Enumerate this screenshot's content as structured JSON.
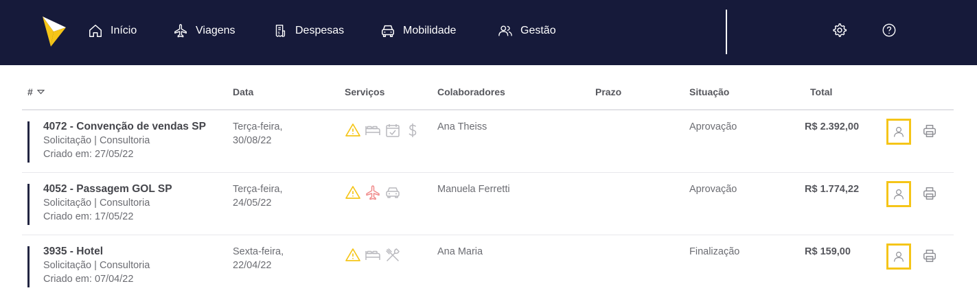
{
  "nav": {
    "items": [
      {
        "label": "Início",
        "icon": "home-icon"
      },
      {
        "label": "Viagens",
        "icon": "airplane-icon"
      },
      {
        "label": "Despesas",
        "icon": "receipt-icon"
      },
      {
        "label": "Mobilidade",
        "icon": "car-icon"
      },
      {
        "label": "Gestão",
        "icon": "users-icon"
      }
    ],
    "right_icons": [
      "gear-icon",
      "help-icon"
    ]
  },
  "colors": {
    "topbar": "#161a3a",
    "accent": "#f5c518",
    "alert": "#f5c518",
    "flight_service": "#f08a8a",
    "row_bar": "#222542"
  },
  "table": {
    "columns": [
      "#",
      "Data",
      "Serviços",
      "Colaboradores",
      "Prazo",
      "Situação",
      "Total"
    ],
    "rows": [
      {
        "title": "4072 - Convenção de vendas SP",
        "type": "Solicitação | Consultoria",
        "created": "Criado em: 27/05/22",
        "weekday": "Terça-feira,",
        "date": "30/08/22",
        "services": [
          "alert-icon",
          "bed-icon",
          "calendar-check-icon",
          "dollar-icon"
        ],
        "collaborator": "Ana Theiss",
        "deadline": "",
        "status": "Aprovação",
        "total": "R$ 2.392,00"
      },
      {
        "title": "4052 - Passagem GOL SP",
        "type": "Solicitação | Consultoria",
        "created": "Criado em: 17/05/22",
        "weekday": "Terça-feira,",
        "date": "24/05/22",
        "services": [
          "alert-icon",
          "airplane-icon",
          "car-icon"
        ],
        "collaborator": "Manuela Ferretti",
        "deadline": "",
        "status": "Aprovação",
        "total": "R$ 1.774,22"
      },
      {
        "title": "3935 - Hotel",
        "type": "Solicitação | Consultoria",
        "created": "Criado em: 07/04/22",
        "weekday": "Sexta-feira,",
        "date": "22/04/22",
        "services": [
          "alert-icon",
          "bed-icon",
          "utensils-icon"
        ],
        "collaborator": "Ana Maria",
        "deadline": "",
        "status": "Finalização",
        "total": "R$ 159,00"
      }
    ]
  }
}
